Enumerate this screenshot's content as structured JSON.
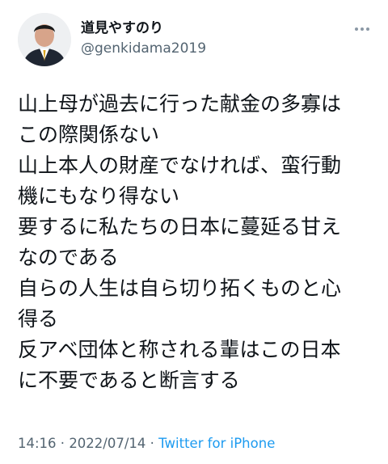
{
  "author": {
    "display_name": "道見やすのり",
    "handle": "@genkidama2019"
  },
  "tweet": {
    "lines": [
      "山上母が過去に行った献金の多寡は",
      "この際関係ない",
      "山上本人の財産でなければ、蛮行動",
      "機にもなり得ない",
      "要するに私たちの日本に蔓延る甘え",
      "なのである",
      "自らの人生は自ら切り拓くものと心",
      "得る",
      "反アベ団体と称される輩はこの日本",
      "に不要であると断言する"
    ]
  },
  "meta": {
    "time": "14:16",
    "separator1": " · ",
    "date": "2022/07/14",
    "separator2": " · ",
    "source": "Twitter for iPhone"
  },
  "colors": {
    "text": "#0f1419",
    "secondary": "#536471",
    "link": "#1d9bf0"
  },
  "icons": {
    "more": "more-dots-icon"
  }
}
